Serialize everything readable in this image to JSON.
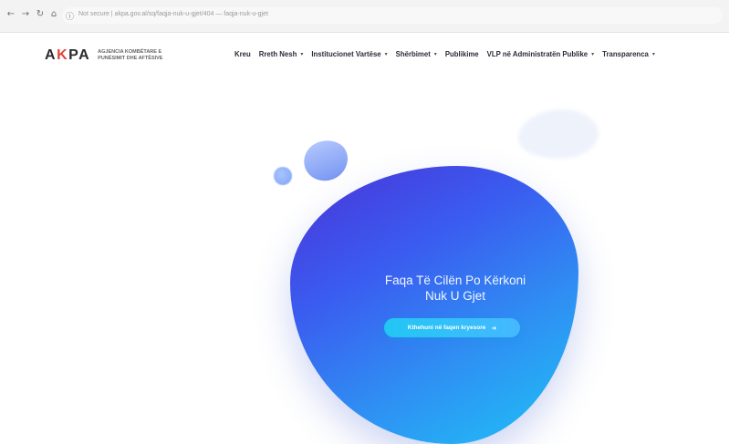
{
  "browser": {
    "back_icon": "arrow-left-icon",
    "forward_icon": "arrow-right-icon",
    "reload_icon": "reload-icon",
    "home_icon": "home-icon",
    "url": "Not secure | akpa.gov.al/sq/faqja-nuk-u-gjet/404 — faqja-nuk-u-gjet"
  },
  "site": {
    "logo_mark_a": "A",
    "logo_mark_k": "K",
    "logo_mark_pa": "PA",
    "logo_subtitle": "Agjencia Kombëtare e Punësimit dhe Aftësive",
    "nav": [
      {
        "label": "Kreu",
        "has_dropdown": false
      },
      {
        "label": "Rreth Nesh",
        "has_dropdown": true
      },
      {
        "label": "Institucionet Vartëse",
        "has_dropdown": true
      },
      {
        "label": "Shërbimet",
        "has_dropdown": true
      },
      {
        "label": "Publikime",
        "has_dropdown": false
      },
      {
        "label": "VLP në Administratën Publike",
        "has_dropdown": true
      },
      {
        "label": "Transparenca",
        "has_dropdown": true
      }
    ],
    "chevron_char": "▾"
  },
  "error": {
    "title_line1": "Faqa Të Cilën Po Kërkoni",
    "title_line2": "Nuk U Gjet",
    "button_label": "Kthehuni në faqen kryesore",
    "button_arrow": "➜"
  },
  "colors": {
    "accent_blue": "#3a5df0",
    "accent_cyan": "#1ec3f6",
    "logo_red": "#e0443e"
  }
}
